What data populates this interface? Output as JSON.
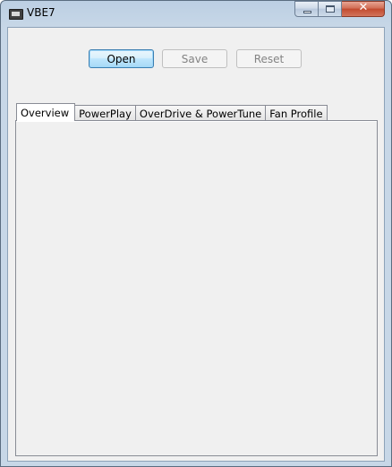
{
  "window": {
    "title": "VBE7",
    "app_icon": "graphics-card-icon",
    "caption_buttons": {
      "minimize": "minimize-icon",
      "maximize": "maximize-icon",
      "close": "close-icon",
      "close_glyph": "✕"
    }
  },
  "toolbar": {
    "open_label": "Open",
    "save_label": "Save",
    "reset_label": "Reset"
  },
  "tabs": [
    {
      "label": "Overview",
      "active": true
    },
    {
      "label": "PowerPlay",
      "active": false
    },
    {
      "label": "OverDrive & PowerTune",
      "active": false
    },
    {
      "label": "Fan Profile",
      "active": false
    }
  ],
  "colors": {
    "titlebar": "#c7d7e7",
    "client_background": "#f0f0f0",
    "close_button": "#c24a2f",
    "open_button_border": "#3c7fb1"
  }
}
